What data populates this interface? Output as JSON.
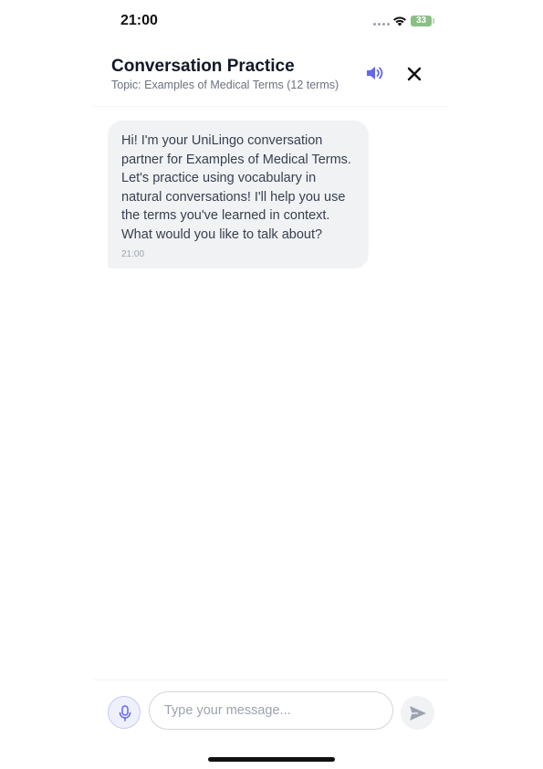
{
  "status_bar": {
    "time": "21:00",
    "battery": "33",
    "signal_icon": "cellular-signal-icon",
    "wifi_icon": "wifi-icon"
  },
  "header": {
    "title": "Conversation Practice",
    "subtitle": "Topic: Examples of Medical Terms (12 terms)",
    "speaker_icon": "speaker-icon",
    "close_icon": "close-icon"
  },
  "messages": [
    {
      "sender": "assistant",
      "text": "Hi! I'm your UniLingo conversation partner for Examples of Medical Terms. Let's practice using vocabulary in natural conversations! I'll help you use the terms you've learned in context. What would you like to talk about?",
      "time": "21:00"
    }
  ],
  "composer": {
    "placeholder": "Type your message...",
    "value": "",
    "mic_icon": "microphone-icon",
    "send_icon": "send-icon"
  },
  "colors": {
    "accent": "#6366f1",
    "bubble_background": "#f1f2f4",
    "battery": "#8bbf86"
  }
}
